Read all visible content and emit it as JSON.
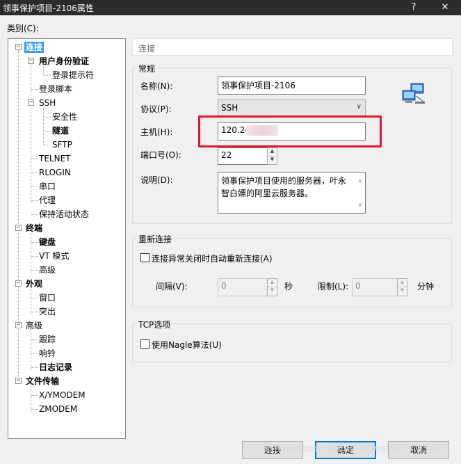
{
  "window": {
    "title": "领事保护项目-2106属性",
    "help_glyph": "?",
    "close_glyph": "✕"
  },
  "category_label": "类别(C):",
  "tree": {
    "connection": "连接",
    "auth": "用户身份验证",
    "login_prompt": "登录提示符",
    "login_script": "登录脚本",
    "ssh": "SSH",
    "security": "安全性",
    "tunnel": "隧道",
    "sftp": "SFTP",
    "telnet": "TELNET",
    "rlogin": "RLOGIN",
    "serial": "串口",
    "proxy": "代理",
    "keepalive": "保持活动状态",
    "terminal": "终端",
    "keyboard": "键盘",
    "vt_mode": "VT 模式",
    "advanced": "高级",
    "appearance": "外观",
    "window": "窗口",
    "highlight": "突出",
    "advanced2": "高级",
    "trace": "跟踪",
    "bell": "响铃",
    "logging": "日志记录",
    "file_transfer": "文件传输",
    "xymodem": "X/YMODEM",
    "zmodem": "ZMODEM"
  },
  "header_text": "连接",
  "general": {
    "group_title": "常规",
    "name_label": "名称(N):",
    "name_value": "领事保护项目-2106",
    "protocol_label": "协议(P):",
    "protocol_value": "SSH",
    "host_label": "主机(H):",
    "host_value": "120.24",
    "port_label": "端口号(O):",
    "port_value": "22",
    "desc_label": "说明(D):",
    "desc_line1": "领事保护项目使用的服务器，叶永",
    "desc_line2": "智白嫖的阿里云服务器。"
  },
  "reconnect": {
    "group_title": "重新连接",
    "checkbox_label": "连接异常关闭时自动重新连接(A)",
    "interval_label": "间隔(V):",
    "interval_value": "0",
    "interval_unit": "秒",
    "limit_label": "限制(L):",
    "limit_value": "0",
    "limit_unit": "分钟"
  },
  "tcp": {
    "group_title": "TCP选项",
    "nagle_label": "使用Nagle算法(U)"
  },
  "buttons": {
    "connect": "连接",
    "ok": "确定",
    "cancel": "取消"
  },
  "watermark": "https://blog.csdn.net/weixin_4  1364",
  "colors": {
    "selection": "#3399ff",
    "highlight_box": "#e3162b",
    "titlebar": "#2b2b2b",
    "default_button_border": "#0078d7"
  }
}
